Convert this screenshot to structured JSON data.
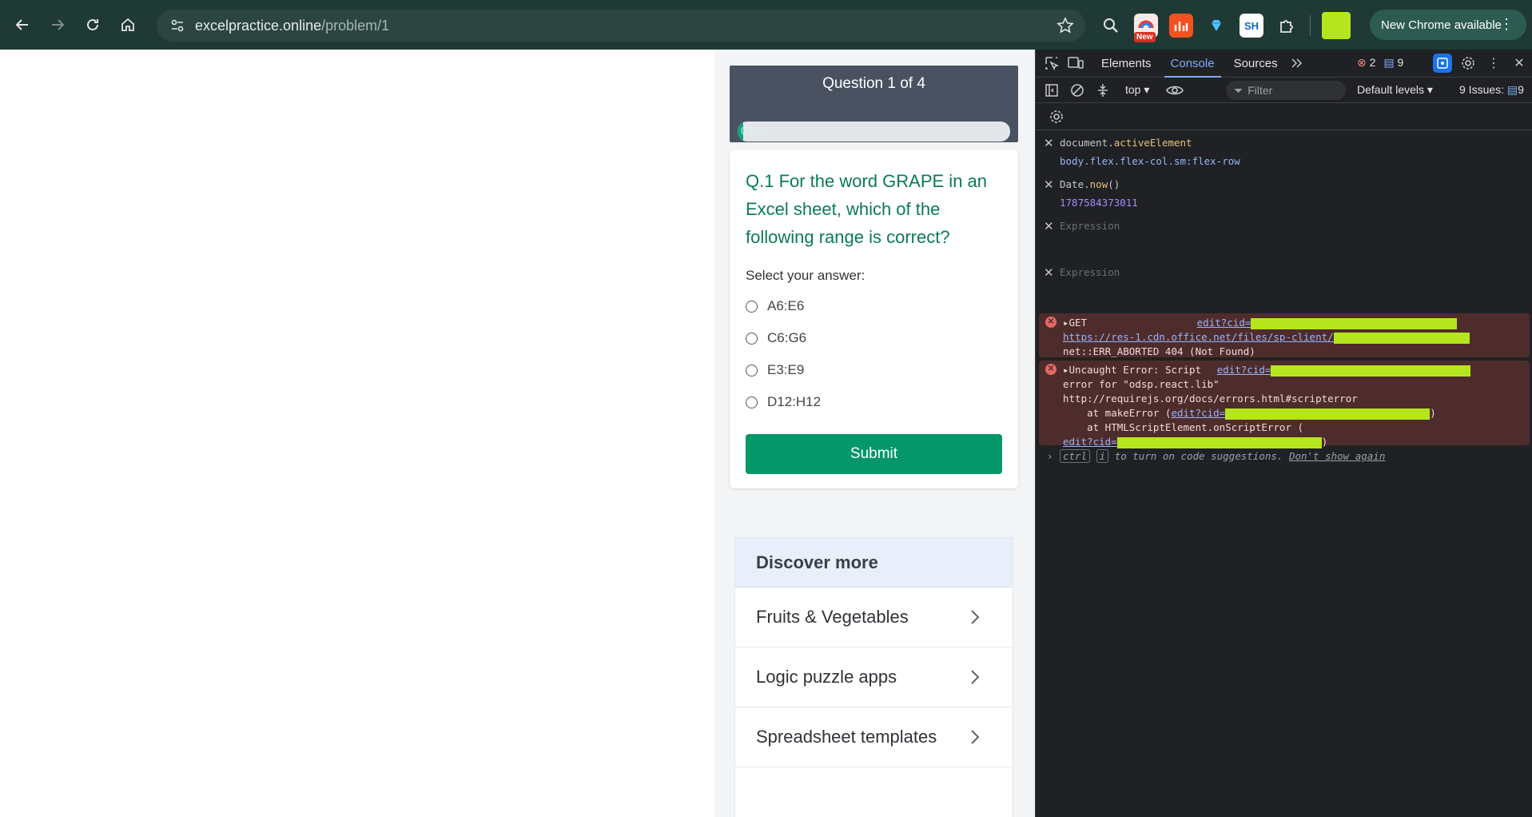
{
  "browser": {
    "url_domain": "excelpractice.online",
    "url_path": "/problem/1",
    "new_badge": "New",
    "update_button": "New Chrome available"
  },
  "quiz": {
    "progress_title": "Question 1 of 4",
    "progress_percent": 2,
    "progress_label": "0.00%",
    "question": "Q.1 For the word GRAPE in an Excel sheet, which of the following range is correct?",
    "prompt": "Select your answer:",
    "options": [
      "A6:E6",
      "C6:G6",
      "E3:E9",
      "D12:H12"
    ],
    "submit": "Submit"
  },
  "discover": {
    "title": "Discover more",
    "items": [
      "Fruits & Vegetables",
      "Logic puzzle apps",
      "Spreadsheet templates"
    ]
  },
  "devtools": {
    "tabs": [
      "Elements",
      "Console",
      "Sources"
    ],
    "error_count": "2",
    "message_count": "9",
    "context": "top ▾",
    "filter_placeholder": "Filter",
    "levels": "Default levels ▾",
    "issues": "9 Issues:",
    "issues_count": "9",
    "live_expressions": [
      {
        "name": "document.",
        "prop": "activeElement",
        "value": "body.flex.flex-col.sm:flex-row"
      },
      {
        "name": "Date.",
        "prop": "now",
        "suffix": "()",
        "value": "1787584373011"
      }
    ],
    "expression_placeholder": "Expression",
    "errors": {
      "e1_method": "GET",
      "e1_link": "edit?cid=",
      "e1_url": "https://res-1.cdn.office.net/files/sp-client/",
      "e1_status": "net::ERR_ABORTED 404 (Not Found)",
      "e2_head": "Uncaught Error: Script",
      "e2_link": "edit?cid=",
      "e2_line2": "error for \"odsp.react.lib\"",
      "e2_line3": "http://requirejs.org/docs/errors.html#scripterror",
      "e2_line4": "    at makeError (",
      "e2_line5": "    at HTMLScriptElement.onScriptError (",
      "e2_link3": "edit?cid="
    },
    "prompt": {
      "kbd1": "ctrl",
      "kbd2": "i",
      "text": " to turn on code suggestions. ",
      "dismiss": "Don't show again"
    }
  }
}
